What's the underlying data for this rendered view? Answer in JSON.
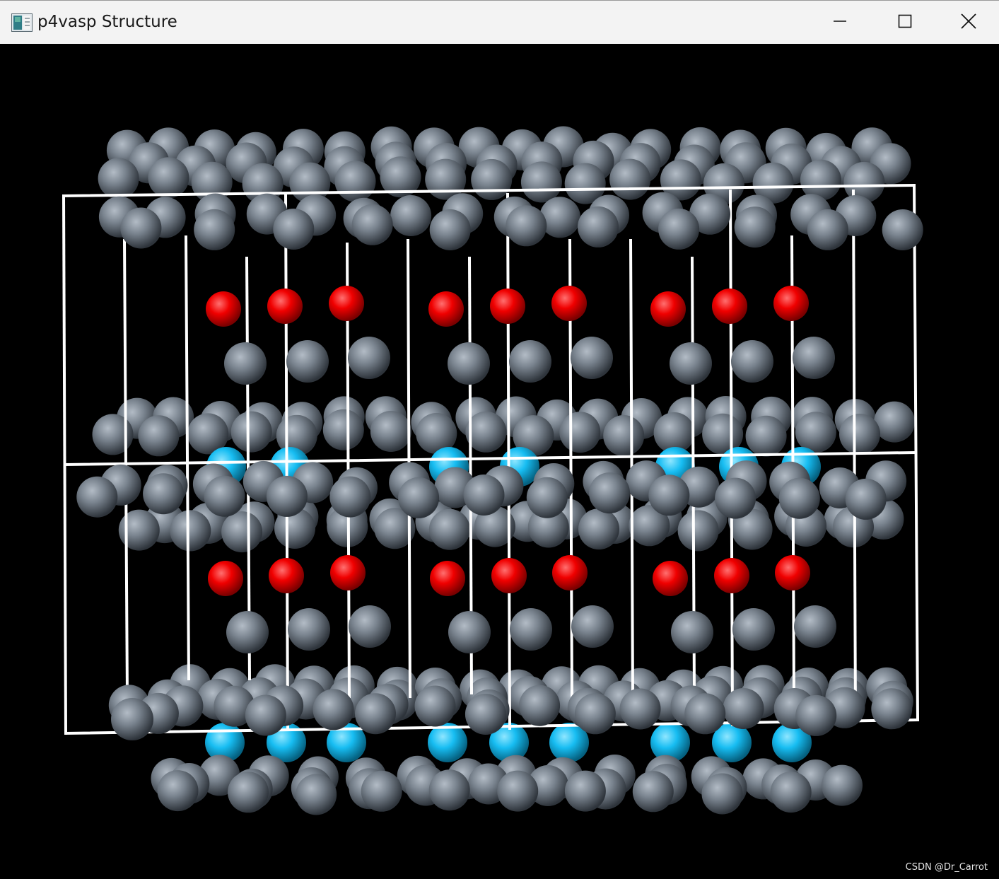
{
  "window": {
    "title": "p4vasp Structure",
    "icons": {
      "app": "p4vasp-app-icon",
      "minimize": "minimize-icon",
      "maximize": "maximize-icon",
      "close": "close-icon"
    }
  },
  "scene": {
    "background": "#000000",
    "atom_colors": {
      "gray": "#8a939e",
      "red": "#ff1a1a",
      "cyan": "#1ec8ff"
    },
    "cell_line_color": "#ffffff"
  },
  "watermark": "CSDN @Dr_Carrot"
}
